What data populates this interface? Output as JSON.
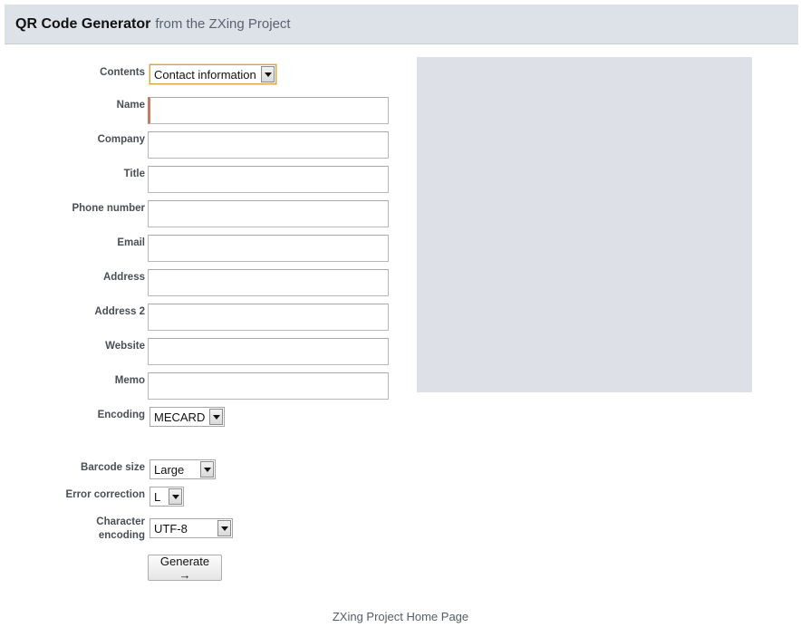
{
  "header": {
    "title": "QR Code Generator",
    "subtitle": "from the ZXing Project"
  },
  "form": {
    "contents_label": "Contents",
    "contents_value": "Contact information",
    "fields": [
      {
        "label": "Name",
        "value": ""
      },
      {
        "label": "Company",
        "value": ""
      },
      {
        "label": "Title",
        "value": ""
      },
      {
        "label": "Phone number",
        "value": ""
      },
      {
        "label": "Email",
        "value": ""
      },
      {
        "label": "Address",
        "value": ""
      },
      {
        "label": "Address 2",
        "value": ""
      },
      {
        "label": "Website",
        "value": ""
      },
      {
        "label": "Memo",
        "value": ""
      }
    ],
    "encoding_label": "Encoding",
    "encoding_value": "MECARD",
    "barcode_size_label": "Barcode size",
    "barcode_size_value": "Large",
    "error_correction_label": "Error correction",
    "error_correction_value": "L",
    "char_encoding_label_line1": "Character",
    "char_encoding_label_line2": "encoding",
    "char_encoding_value": "UTF-8",
    "generate_label": "Generate →"
  },
  "footer": {
    "link": "ZXing Project Home Page"
  },
  "colors": {
    "header_bg": "#dde2e9",
    "preview_bg": "#dde1e7",
    "active_field_accent": "#d9745a"
  }
}
